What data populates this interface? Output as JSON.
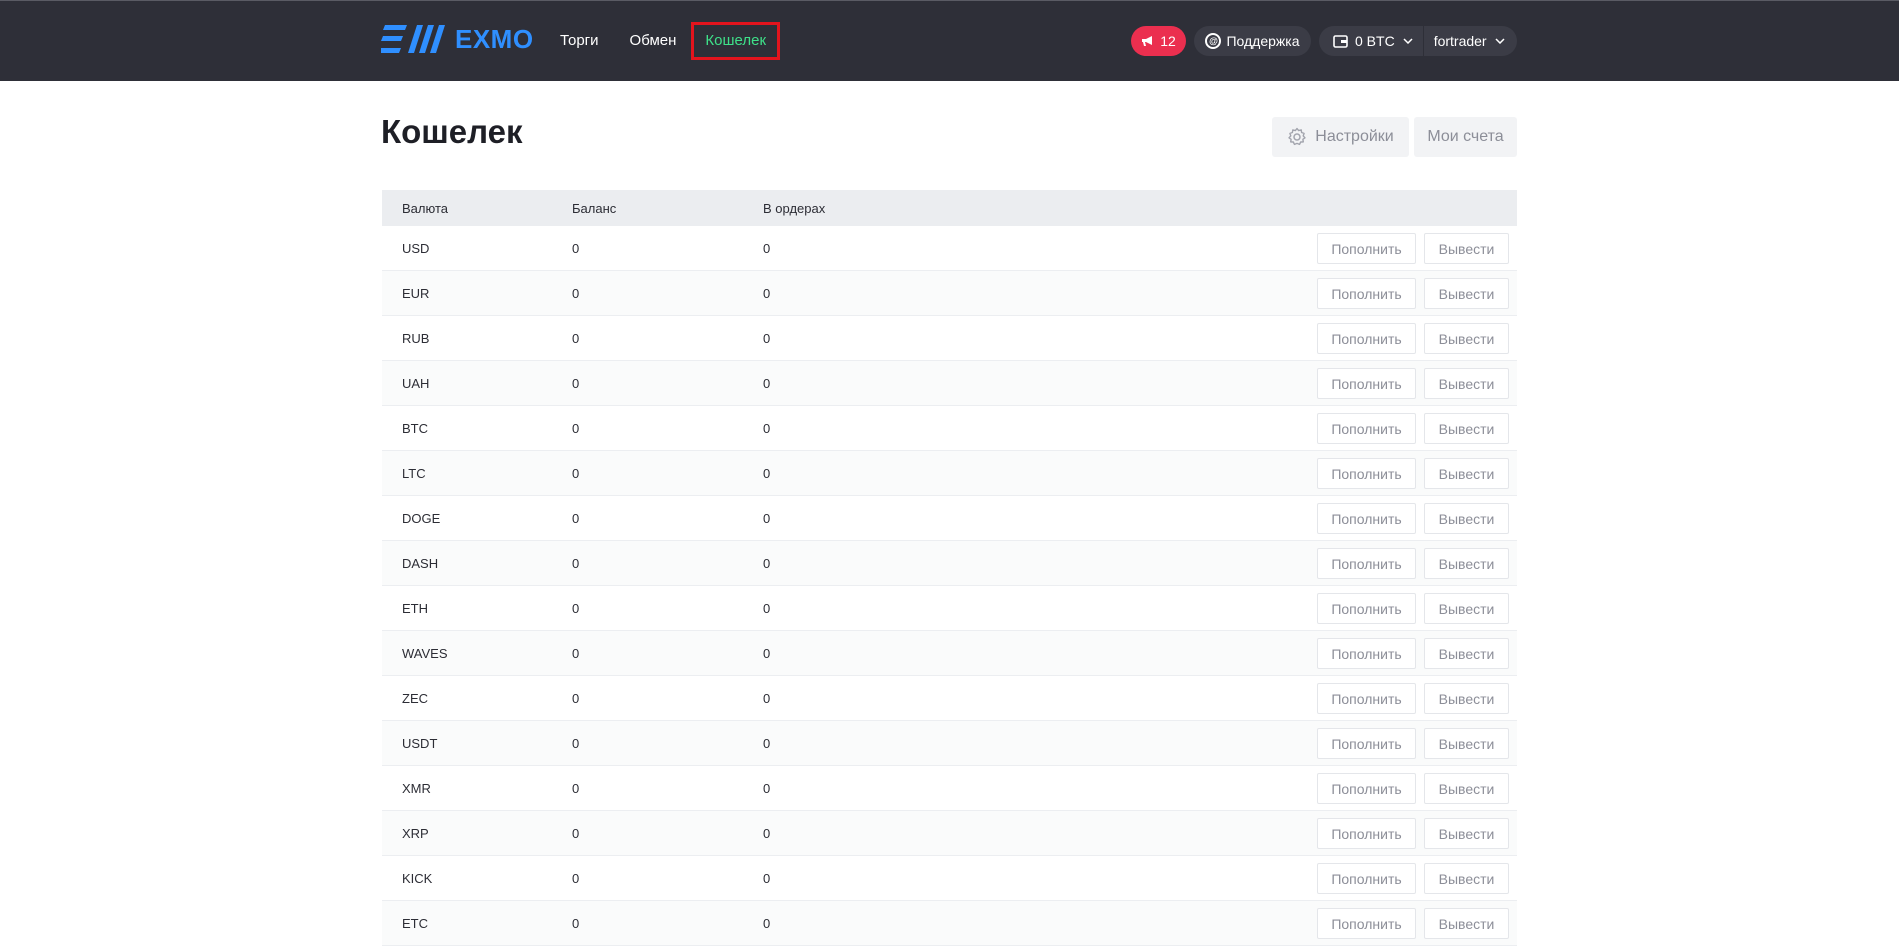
{
  "header": {
    "logo_text": "EXMO",
    "nav": {
      "trade": "Торги",
      "exchange": "Обмен",
      "wallet": "Кошелек"
    },
    "notifications_count": "12",
    "support_label": "Поддержка",
    "balance_label": "0 BTC",
    "username": "fortrader",
    "colors": {
      "background": "#2e2f38",
      "accent_blue": "#2f8fff",
      "active_nav": "#3ee089",
      "alert": "#eb2f4f"
    }
  },
  "page": {
    "title": "Кошелек",
    "settings_label": "Настройки",
    "accounts_label": "Мои счета"
  },
  "table": {
    "columns": {
      "currency": "Валюта",
      "balance": "Баланс",
      "in_orders": "В ордерах"
    },
    "deposit_label": "Пополнить",
    "withdraw_label": "Вывести",
    "rows": [
      {
        "currency": "USD",
        "balance": "0",
        "in_orders": "0"
      },
      {
        "currency": "EUR",
        "balance": "0",
        "in_orders": "0"
      },
      {
        "currency": "RUB",
        "balance": "0",
        "in_orders": "0"
      },
      {
        "currency": "UAH",
        "balance": "0",
        "in_orders": "0"
      },
      {
        "currency": "BTC",
        "balance": "0",
        "in_orders": "0"
      },
      {
        "currency": "LTC",
        "balance": "0",
        "in_orders": "0"
      },
      {
        "currency": "DOGE",
        "balance": "0",
        "in_orders": "0"
      },
      {
        "currency": "DASH",
        "balance": "0",
        "in_orders": "0"
      },
      {
        "currency": "ETH",
        "balance": "0",
        "in_orders": "0"
      },
      {
        "currency": "WAVES",
        "balance": "0",
        "in_orders": "0"
      },
      {
        "currency": "ZEC",
        "balance": "0",
        "in_orders": "0"
      },
      {
        "currency": "USDT",
        "balance": "0",
        "in_orders": "0"
      },
      {
        "currency": "XMR",
        "balance": "0",
        "in_orders": "0"
      },
      {
        "currency": "XRP",
        "balance": "0",
        "in_orders": "0"
      },
      {
        "currency": "KICK",
        "balance": "0",
        "in_orders": "0"
      },
      {
        "currency": "ETC",
        "balance": "0",
        "in_orders": "0"
      }
    ]
  }
}
